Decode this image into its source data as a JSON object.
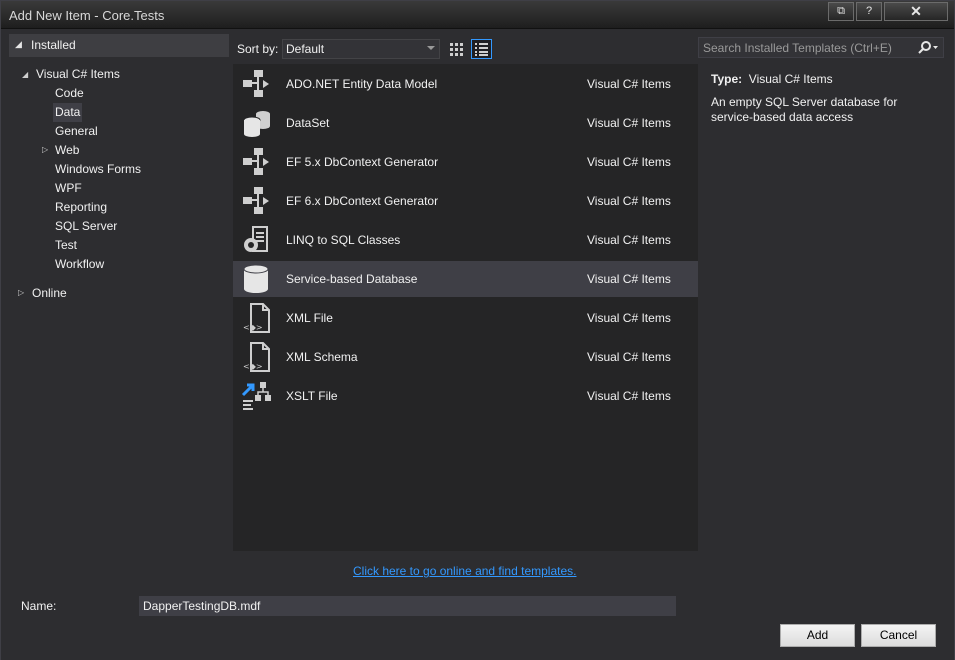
{
  "window": {
    "title": "Add New Item - Core.Tests"
  },
  "title_buttons": {
    "restore_glyph": "⧉",
    "help_glyph": "?",
    "close_glyph": "✕"
  },
  "tree": {
    "installed_label": "Installed",
    "root_label": "Visual C# Items",
    "children": [
      "Code",
      "Data",
      "General",
      "Web",
      "Windows Forms",
      "WPF",
      "Reporting",
      "SQL Server",
      "Test",
      "Workflow"
    ],
    "selected": "Data",
    "online_label": "Online"
  },
  "toolbar": {
    "sort_label": "Sort by:",
    "sort_value": "Default",
    "search_placeholder": "Search Installed Templates (Ctrl+E)"
  },
  "templates": [
    {
      "name": "ADO.NET Entity Data Model",
      "category": "Visual C# Items",
      "icon": "entity-model-icon"
    },
    {
      "name": "DataSet",
      "category": "Visual C# Items",
      "icon": "dataset-icon"
    },
    {
      "name": "EF 5.x DbContext Generator",
      "category": "Visual C# Items",
      "icon": "ef-generator-icon"
    },
    {
      "name": "EF 6.x DbContext Generator",
      "category": "Visual C# Items",
      "icon": "ef-generator-icon"
    },
    {
      "name": "LINQ to SQL Classes",
      "category": "Visual C# Items",
      "icon": "linq-classes-icon"
    },
    {
      "name": "Service-based Database",
      "category": "Visual C# Items",
      "icon": "database-icon",
      "selected": true
    },
    {
      "name": "XML File",
      "category": "Visual C# Items",
      "icon": "xml-file-icon"
    },
    {
      "name": "XML Schema",
      "category": "Visual C# Items",
      "icon": "xml-schema-icon"
    },
    {
      "name": "XSLT File",
      "category": "Visual C# Items",
      "icon": "xslt-file-icon"
    }
  ],
  "details": {
    "type_label": "Type:",
    "type_value": "Visual C# Items",
    "description": "An empty SQL Server database for service-based data access"
  },
  "online_link": "Click here to go online and find templates.",
  "name_field": {
    "label": "Name:",
    "value": "DapperTestingDB.mdf"
  },
  "buttons": {
    "add": "Add",
    "cancel": "Cancel"
  }
}
